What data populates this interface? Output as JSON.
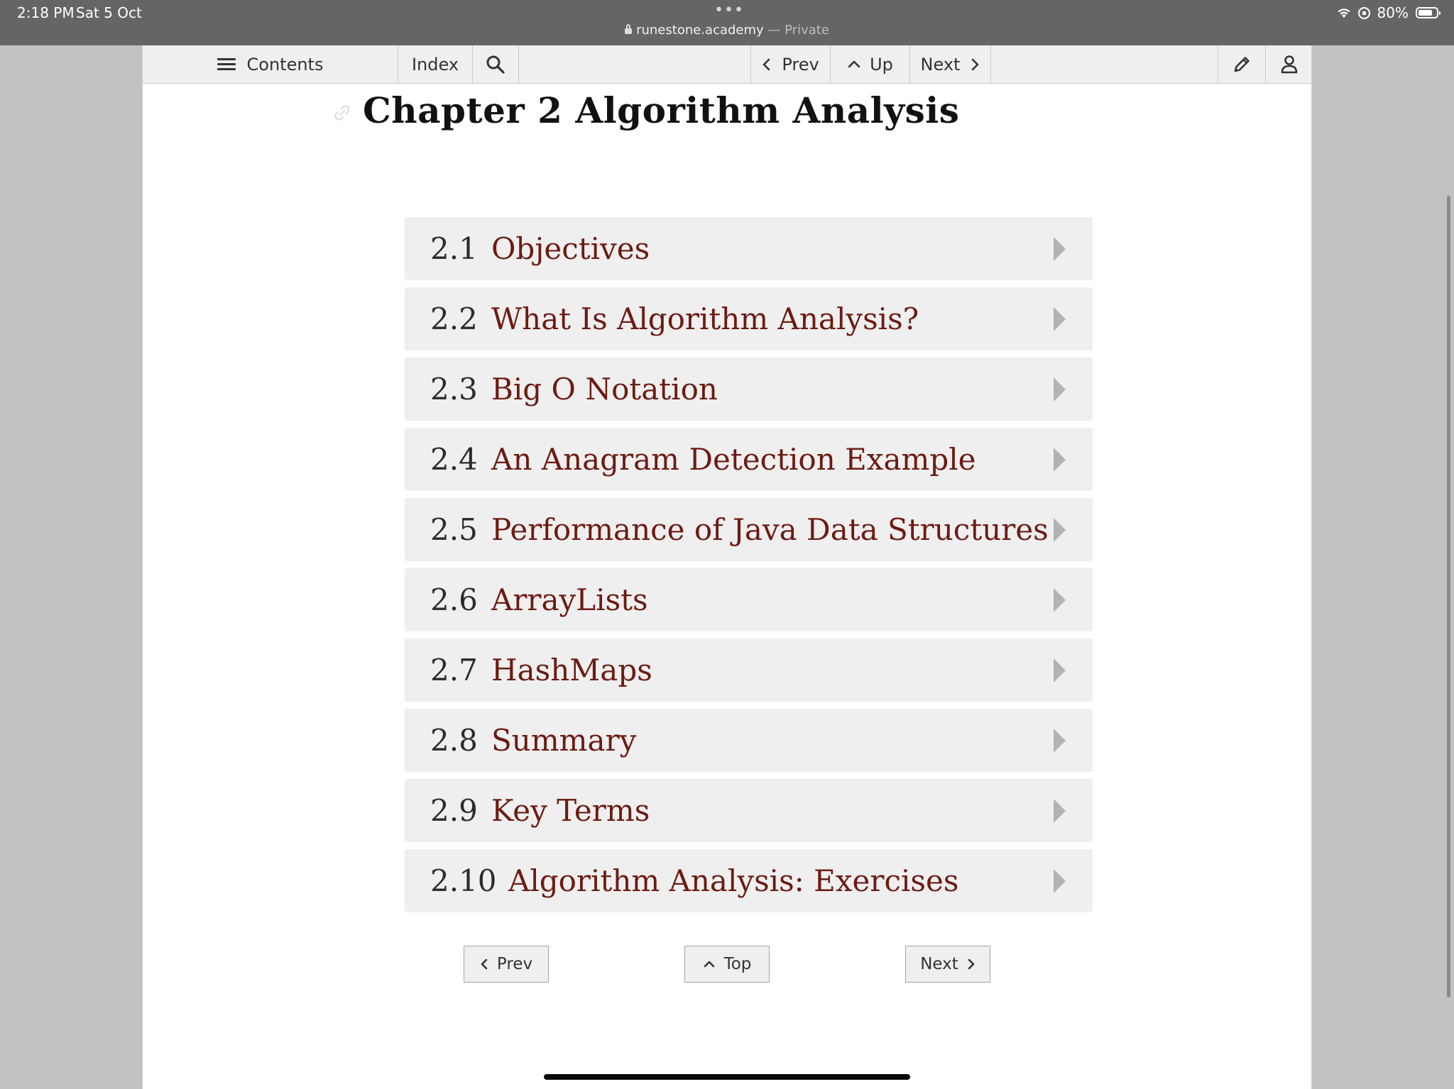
{
  "status_bar": {
    "time": "2:18 PM",
    "date": "Sat 5 Oct",
    "url": "runestone.academy",
    "url_separator": " — ",
    "private_label": "Private",
    "battery": "80%",
    "battery_level": 0.8
  },
  "toolbar": {
    "contents_label": "Contents",
    "index_label": "Index",
    "prev_label": "Prev",
    "up_label": "Up",
    "next_label": "Next"
  },
  "chapter": {
    "title": "Chapter 2 Algorithm Analysis"
  },
  "toc": [
    {
      "number": "2.1",
      "title": "Objectives"
    },
    {
      "number": "2.2",
      "title": "What Is Algorithm Analysis?"
    },
    {
      "number": "2.3",
      "title": "Big O Notation"
    },
    {
      "number": "2.4",
      "title": "An Anagram Detection Example"
    },
    {
      "number": "2.5",
      "title": "Performance of Java Data Structures"
    },
    {
      "number": "2.6",
      "title": "ArrayLists"
    },
    {
      "number": "2.7",
      "title": "HashMaps"
    },
    {
      "number": "2.8",
      "title": "Summary"
    },
    {
      "number": "2.9",
      "title": "Key Terms"
    },
    {
      "number": "2.10",
      "title": "Algorithm Analysis: Exercises"
    }
  ],
  "bottom_nav": {
    "prev_label": "Prev",
    "top_label": "Top",
    "next_label": "Next"
  },
  "colors": {
    "toc_title": "#6c1b12",
    "toc_background": "#efefef",
    "status_bar": "#656565"
  }
}
